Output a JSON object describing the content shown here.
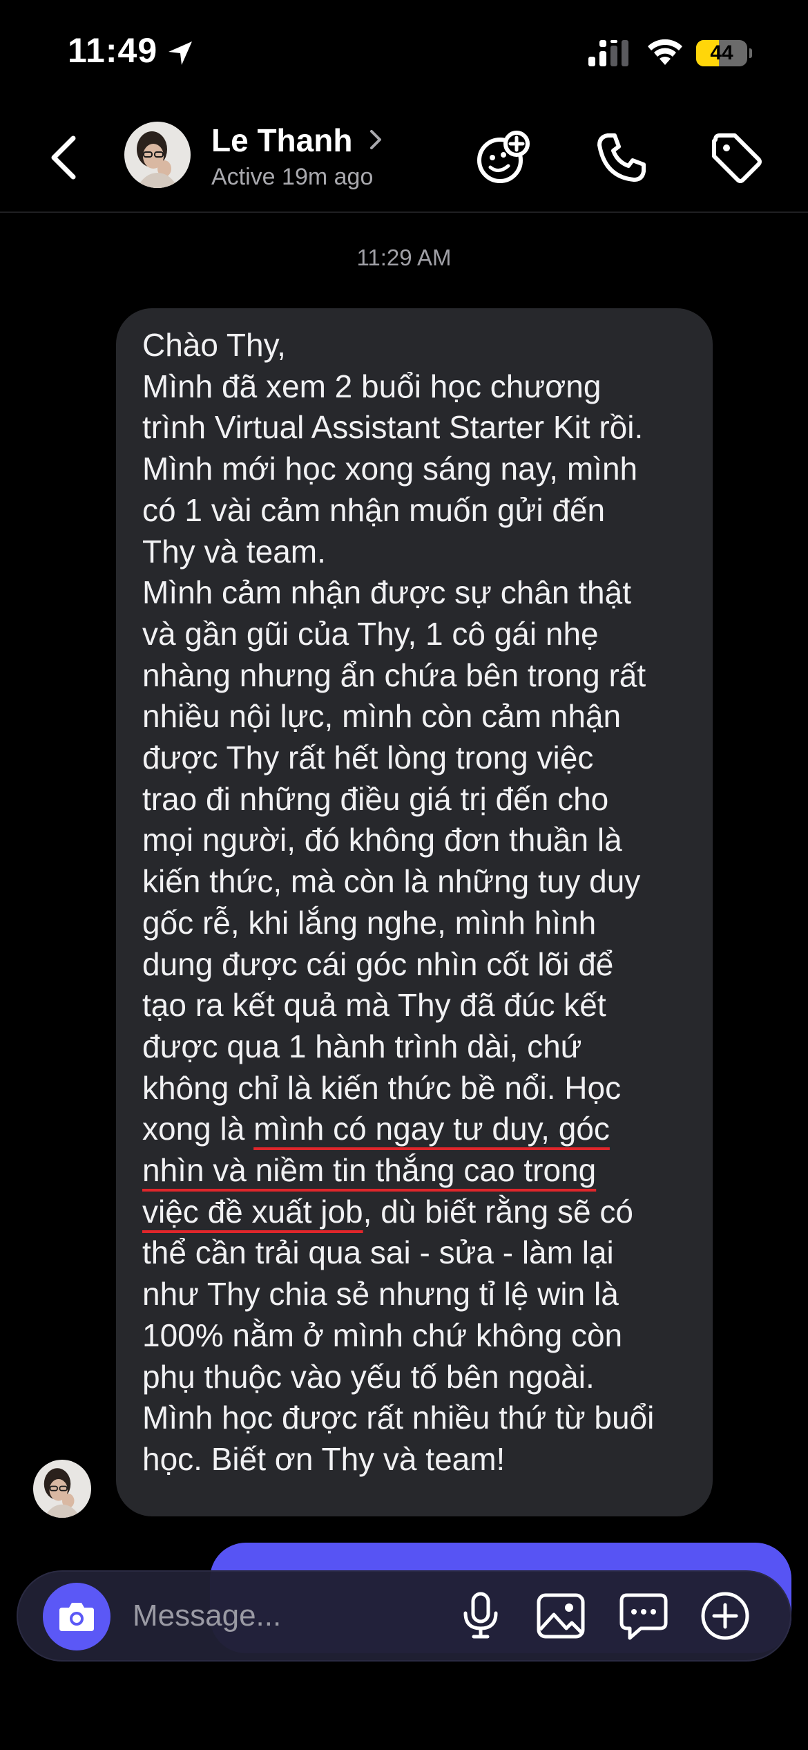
{
  "status_bar": {
    "time": "11:49",
    "battery": "44",
    "battery_level": 0.44,
    "battery_color": "#ffd60a"
  },
  "header": {
    "contact_name": "Le Thanh",
    "status": "Active 19m ago",
    "icons": [
      "back-arrow-icon",
      "chevron-right-icon",
      "effects-icon",
      "phone-icon",
      "tag-icon"
    ]
  },
  "conversation": {
    "timestamp": "11:29 AM",
    "message_lines": [
      "Chào Thy,",
      "Mình đã xem 2 buổi học chương",
      "trình Virtual Assistant Starter Kit rồi.",
      "Mình mới học xong sáng nay, mình",
      "có 1 vài cảm nhận muốn gửi đến",
      "Thy và team.",
      "Mình cảm nhận được sự chân thật",
      "và gần gũi của Thy, 1 cô gái nhẹ",
      "nhàng nhưng ẩn chứa bên trong rất",
      "nhiều nội lực, mình còn cảm nhận",
      "được Thy rất hết lòng trong việc",
      "trao đi những điều giá trị đến cho",
      "mọi người, đó không đơn thuần là",
      "kiến thức, mà còn là những tuy duy",
      "gốc rễ, khi lắng nghe, mình hình",
      "dung được cái góc nhìn cốt lõi để",
      "tạo ra kết quả mà Thy đã đúc kết",
      "được qua 1 hành trình dài, chứ",
      "không chỉ là kiến thức bề nổi. Học"
    ],
    "hl_line1": {
      "pre": "xong là ",
      "mark": "mình có ngay tư duy, góc"
    },
    "hl_line2": {
      "mark": "nhìn và niềm tin thắng cao trong"
    },
    "hl_line3": {
      "mark": "việc đề xuất job",
      "post": ", dù biết rằng sẽ có"
    },
    "message_tail": [
      "thể cần trải qua sai - sửa - làm lại",
      "như Thy chia sẻ nhưng tỉ lệ win là",
      "100% nằm ở mình chứ không còn",
      "phụ thuộc vào yếu tố bên ngoài.",
      "Mình học được rất nhiều thứ từ buổi",
      "học. Biết ơn Thy và team!"
    ],
    "highlight_color": "#e0262b",
    "incoming_bubble_color": "#27282c",
    "outgoing_bubble_color": "#5754f4"
  },
  "composer": {
    "placeholder": "Message...",
    "accent_color": "#5b58f6",
    "icons": [
      "camera-icon",
      "microphone-icon",
      "gallery-icon",
      "sticker-icon",
      "plus-icon"
    ]
  }
}
